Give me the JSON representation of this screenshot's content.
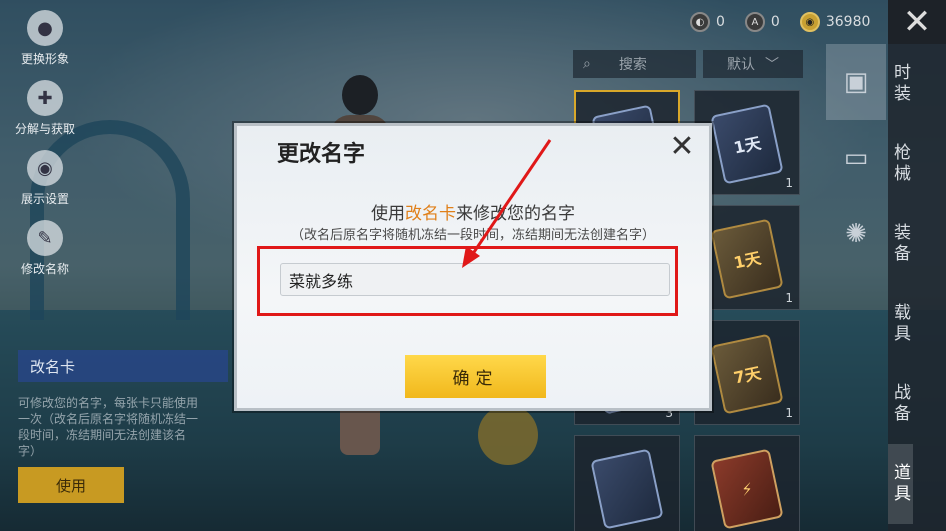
{
  "top_bar": {
    "currencies": [
      {
        "icon": "dark-coin-icon",
        "value": "0"
      },
      {
        "icon": "a-coin-icon",
        "value": "0"
      },
      {
        "icon": "gold-coin-icon",
        "value": "36980"
      }
    ],
    "close_icon": "close-icon"
  },
  "left_menu": [
    {
      "label": "更换形象",
      "icon": "avatar-icon"
    },
    {
      "label": "分解与获取",
      "icon": "puzzle-icon"
    },
    {
      "label": "展示设置",
      "icon": "eye-icon"
    },
    {
      "label": "修改名称",
      "icon": "edit-icon"
    }
  ],
  "item_panel": {
    "name": "改名卡",
    "description": "可修改您的名字，每张卡只能使用一次（改名后原名字将随机冻结一段时间，冻结期间无法创建该名字）",
    "use_button": "使用"
  },
  "inventory": {
    "search_placeholder": "搜索",
    "sort_label": "默认",
    "items": [
      {
        "label": "",
        "qty": "",
        "style": "blue",
        "selected": true
      },
      {
        "label": "1天",
        "qty": "1",
        "style": "blue",
        "selected": false
      },
      {
        "label": "",
        "qty": "",
        "style": "blue",
        "selected": false
      },
      {
        "label": "1天",
        "qty": "1",
        "style": "gold",
        "selected": false
      },
      {
        "label": "",
        "qty": "3",
        "style": "blue",
        "selected": false
      },
      {
        "label": "7天",
        "qty": "1",
        "style": "gold",
        "selected": false
      },
      {
        "label": "",
        "qty": "",
        "style": "blue",
        "selected": false
      },
      {
        "label": "",
        "qty": "",
        "style": "red",
        "selected": false
      }
    ]
  },
  "right_tabs": [
    "时装",
    "枪械",
    "装备",
    "载具",
    "战备",
    "道具"
  ],
  "active_tab": "道具",
  "dialog": {
    "title": "更改名字",
    "line1_prefix": "使用",
    "line1_highlight": "改名卡",
    "line1_suffix": "来修改您的名字",
    "line2": "（改名后原名字将随机冻结一段时间，冻结期间无法创建名字）",
    "name_value": "菜就多练",
    "confirm_label": "确定"
  },
  "colors": {
    "highlight_orange": "#e0801a",
    "confirm_yellow": "#f1b81c",
    "annotation_red": "#e01818"
  }
}
